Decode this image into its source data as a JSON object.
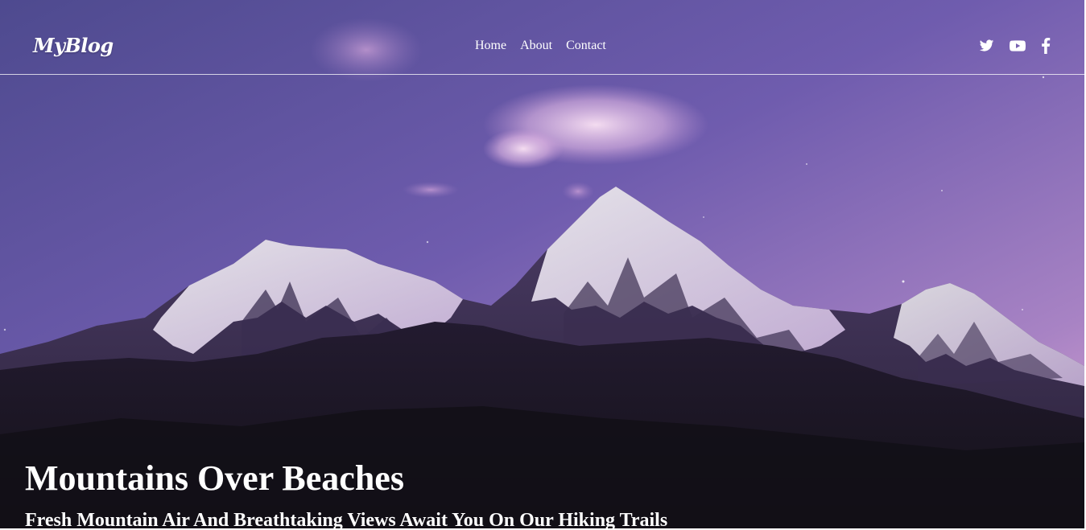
{
  "header": {
    "logo": "MyBlog",
    "nav": [
      {
        "label": "Home"
      },
      {
        "label": "About"
      },
      {
        "label": "Contact"
      }
    ],
    "social": [
      "twitter-icon",
      "youtube-icon",
      "facebook-icon"
    ]
  },
  "hero": {
    "title": "Mountains Over Beaches",
    "subtitle": "Fresh Mountain Air And Breathtaking Views Await You On Our Hiking Trails"
  },
  "colors": {
    "sky_top": "#5b4f96",
    "sky_glow": "#b18ac4",
    "mountain_dark": "#16121e",
    "text": "#ffffff"
  }
}
